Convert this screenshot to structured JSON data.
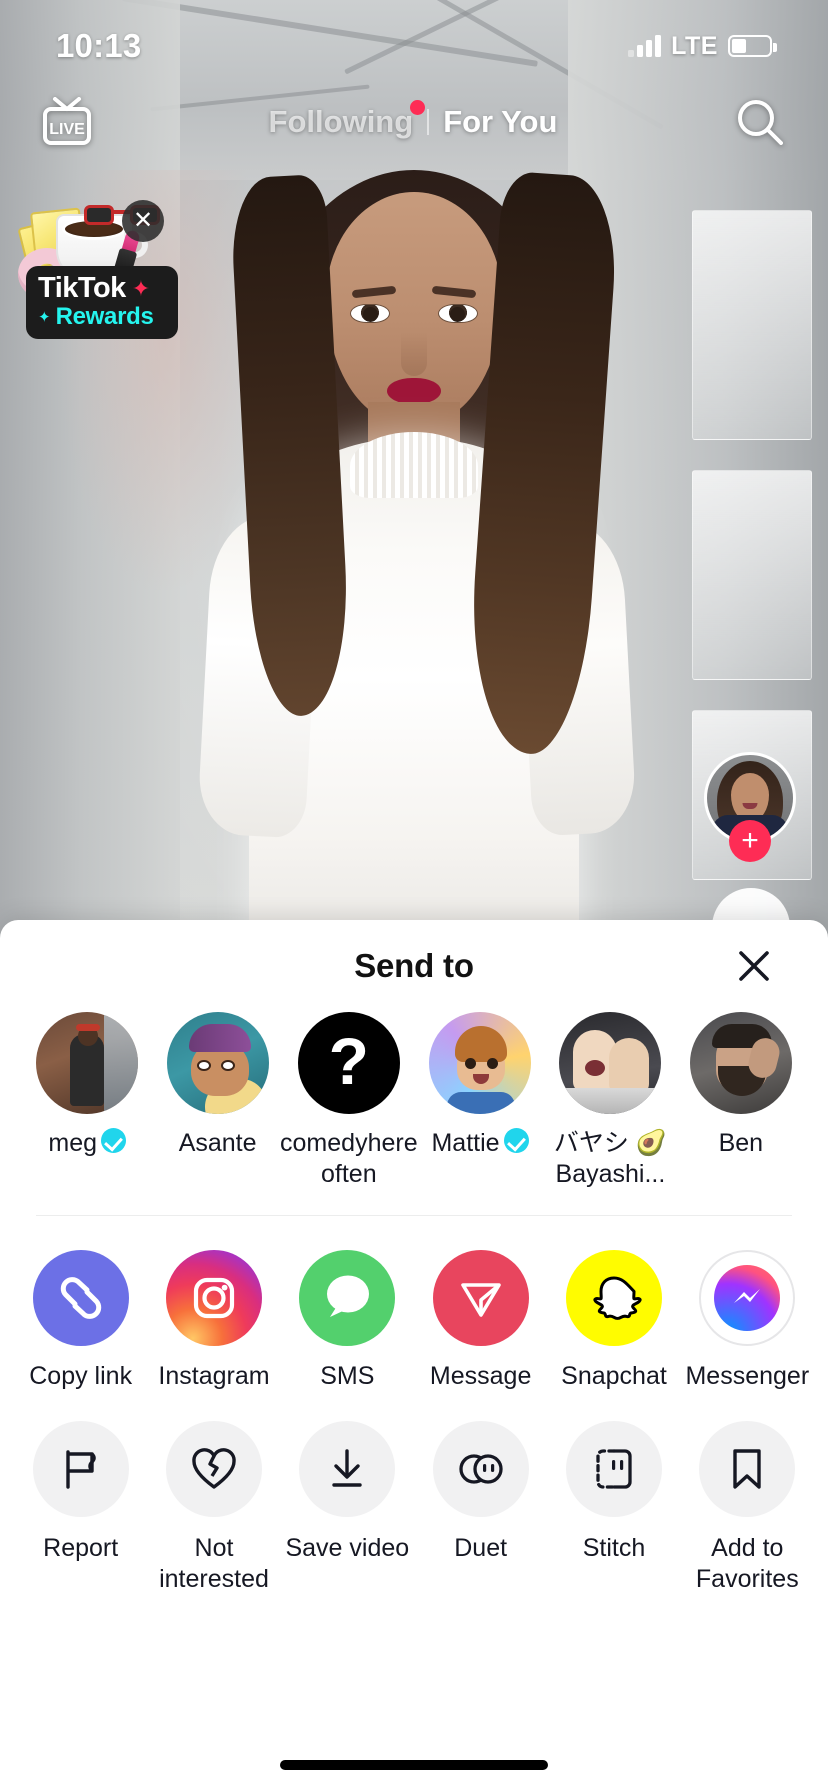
{
  "status_bar": {
    "time": "10:13",
    "network": "LTE",
    "battery_level": 38
  },
  "top_nav": {
    "live_label": "LIVE",
    "tabs": [
      {
        "label": "Following",
        "active": false,
        "has_dot": true
      },
      {
        "label": "For You",
        "active": true,
        "has_dot": false
      }
    ],
    "search_icon": "search-icon"
  },
  "rewards_banner": {
    "brand": "TikTok",
    "subtitle": "Rewards",
    "star_glyph": "✦",
    "sparkle_glyph": "✦",
    "close_glyph": "✕",
    "brand_color": "#FFFFFF",
    "subtitle_color": "#25F4EE",
    "star_color": "#FE2C55",
    "background_color": "#1C1C1C"
  },
  "video_rail": {
    "avatar_name": "creator-avatar",
    "follow_glyph": "+",
    "follow_color": "#FE2C55"
  },
  "share_sheet": {
    "title": "Send to",
    "close_glyph": "✕",
    "contacts": [
      {
        "name": "meg",
        "verified": true,
        "avatar": "meg-avatar"
      },
      {
        "name": "Asante",
        "verified": false,
        "avatar": "asante-avatar"
      },
      {
        "name": "comedyhere often",
        "verified": false,
        "avatar": "comedyhereoften-avatar"
      },
      {
        "name": "Mattie",
        "verified": true,
        "avatar": "mattie-avatar"
      },
      {
        "name": "バヤシ 🥑Bayashi...",
        "verified": false,
        "avatar": "bayashi-avatar"
      },
      {
        "name": "Ben",
        "verified": false,
        "avatar": "ben-avatar"
      }
    ],
    "apps": [
      {
        "label": "Copy link",
        "icon": "link-icon",
        "color": "#6C70E6"
      },
      {
        "label": "Instagram",
        "icon": "instagram-icon",
        "color": "#D92E7F"
      },
      {
        "label": "SMS",
        "icon": "chat-bubble-icon",
        "color": "#53D06D"
      },
      {
        "label": "Message",
        "icon": "send-triangle-icon",
        "color": "#E8455E"
      },
      {
        "label": "Snapchat",
        "icon": "snapchat-ghost-icon",
        "color": "#FFFC00"
      },
      {
        "label": "Messenger",
        "icon": "messenger-icon",
        "color": "#0099FF"
      }
    ],
    "actions": [
      {
        "label": "Report",
        "icon": "flag-icon"
      },
      {
        "label": "Not interested",
        "icon": "broken-heart-icon"
      },
      {
        "label": "Save video",
        "icon": "download-icon"
      },
      {
        "label": "Duet",
        "icon": "duet-circles-icon"
      },
      {
        "label": "Stitch",
        "icon": "stitch-icon"
      },
      {
        "label": "Add to Favorites",
        "icon": "bookmark-icon"
      }
    ]
  }
}
